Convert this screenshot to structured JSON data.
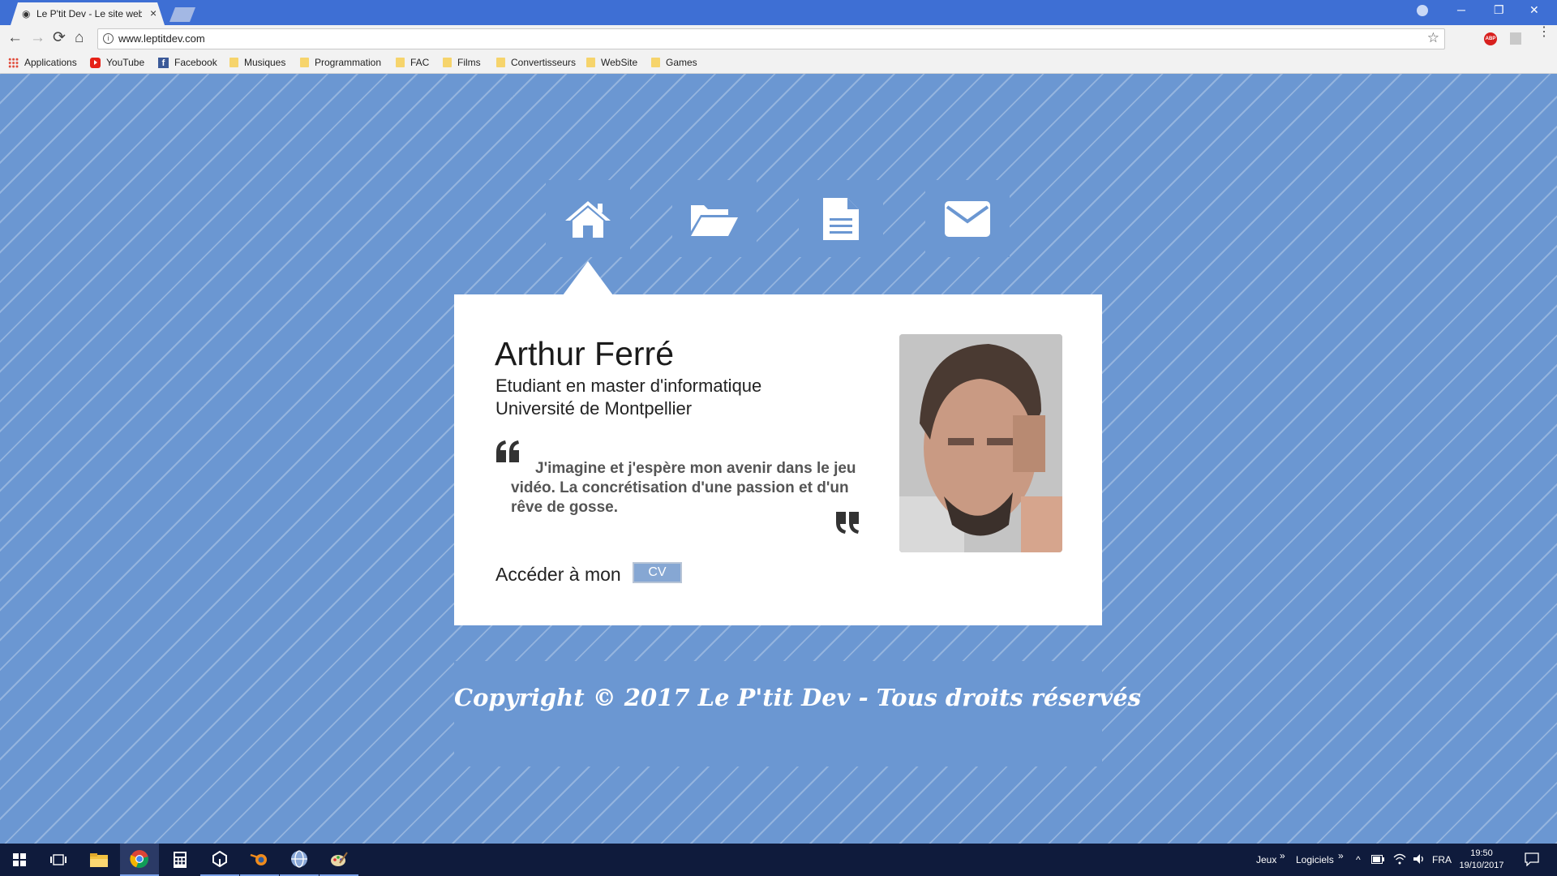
{
  "browser": {
    "tab_title": "Le P'tit Dev - Le site web",
    "tab_close": "×",
    "url": "www.leptitdev.com",
    "window_controls": {
      "minimize": "─",
      "restore": "❐",
      "close": "✕"
    },
    "nav": {
      "back": "←",
      "forward": "→",
      "reload": "⟳",
      "home": "⌂"
    },
    "star": "☆",
    "ext_abp": "ABP",
    "menu": "⋮",
    "bookmarks": [
      {
        "label": "Applications",
        "icon": "apps-grid-icon"
      },
      {
        "label": "YouTube",
        "icon": "youtube-icon"
      },
      {
        "label": "Facebook",
        "icon": "facebook-icon"
      },
      {
        "label": "Musiques",
        "icon": "folder-icon"
      },
      {
        "label": "Programmation",
        "icon": "folder-icon"
      },
      {
        "label": "FAC",
        "icon": "folder-icon"
      },
      {
        "label": "Films",
        "icon": "folder-icon"
      },
      {
        "label": "Convertisseurs",
        "icon": "folder-icon"
      },
      {
        "label": "WebSite",
        "icon": "folder-icon"
      },
      {
        "label": "Games",
        "icon": "folder-icon"
      }
    ]
  },
  "site": {
    "nav_icons": [
      "home-icon",
      "folder-open-icon",
      "document-icon",
      "envelope-icon"
    ],
    "active_nav": "home",
    "profile": {
      "name": "Arthur Ferré",
      "line1": "Etudiant en master d'informatique",
      "line2": "Université de Montpellier",
      "quote": "J'imagine et j'espère mon avenir dans le jeu vidéo. La concrétisation d'une passion et d'un rêve de gosse.",
      "cv_label": "Accéder à mon",
      "cv_button": "CV"
    },
    "footer": "Copyright © 2017 Le P'tit Dev - Tous droits réservés"
  },
  "taskbar": {
    "jeux": "Jeux",
    "logiciels": "Logiciels",
    "chevron": "»",
    "caret": "^",
    "lang": "FRA",
    "time": "19:50",
    "date": "19/10/2017"
  },
  "colors": {
    "page_bg": "#6b97d2",
    "chrome_frame": "#3e6fd4",
    "taskbar": "#0f1b3c",
    "cv_button": "#86a7d3"
  }
}
